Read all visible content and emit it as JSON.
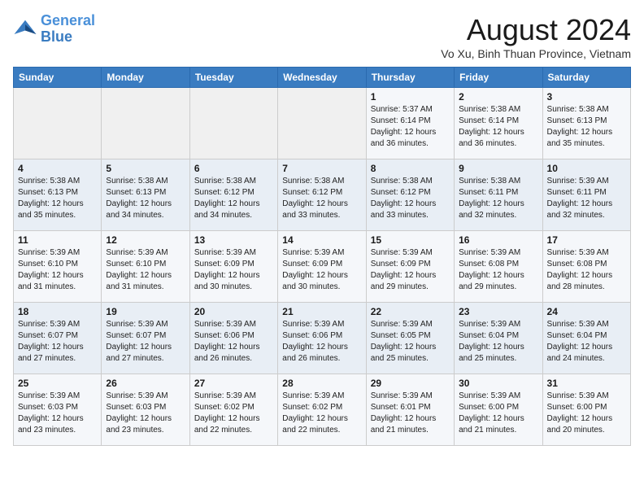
{
  "logo": {
    "line1": "General",
    "line2": "Blue"
  },
  "title": "August 2024",
  "location": "Vo Xu, Binh Thuan Province, Vietnam",
  "days_of_week": [
    "Sunday",
    "Monday",
    "Tuesday",
    "Wednesday",
    "Thursday",
    "Friday",
    "Saturday"
  ],
  "weeks": [
    [
      {
        "day": "",
        "info": ""
      },
      {
        "day": "",
        "info": ""
      },
      {
        "day": "",
        "info": ""
      },
      {
        "day": "",
        "info": ""
      },
      {
        "day": "1",
        "info": "Sunrise: 5:37 AM\nSunset: 6:14 PM\nDaylight: 12 hours\nand 36 minutes."
      },
      {
        "day": "2",
        "info": "Sunrise: 5:38 AM\nSunset: 6:14 PM\nDaylight: 12 hours\nand 36 minutes."
      },
      {
        "day": "3",
        "info": "Sunrise: 5:38 AM\nSunset: 6:13 PM\nDaylight: 12 hours\nand 35 minutes."
      }
    ],
    [
      {
        "day": "4",
        "info": "Sunrise: 5:38 AM\nSunset: 6:13 PM\nDaylight: 12 hours\nand 35 minutes."
      },
      {
        "day": "5",
        "info": "Sunrise: 5:38 AM\nSunset: 6:13 PM\nDaylight: 12 hours\nand 34 minutes."
      },
      {
        "day": "6",
        "info": "Sunrise: 5:38 AM\nSunset: 6:12 PM\nDaylight: 12 hours\nand 34 minutes."
      },
      {
        "day": "7",
        "info": "Sunrise: 5:38 AM\nSunset: 6:12 PM\nDaylight: 12 hours\nand 33 minutes."
      },
      {
        "day": "8",
        "info": "Sunrise: 5:38 AM\nSunset: 6:12 PM\nDaylight: 12 hours\nand 33 minutes."
      },
      {
        "day": "9",
        "info": "Sunrise: 5:38 AM\nSunset: 6:11 PM\nDaylight: 12 hours\nand 32 minutes."
      },
      {
        "day": "10",
        "info": "Sunrise: 5:39 AM\nSunset: 6:11 PM\nDaylight: 12 hours\nand 32 minutes."
      }
    ],
    [
      {
        "day": "11",
        "info": "Sunrise: 5:39 AM\nSunset: 6:10 PM\nDaylight: 12 hours\nand 31 minutes."
      },
      {
        "day": "12",
        "info": "Sunrise: 5:39 AM\nSunset: 6:10 PM\nDaylight: 12 hours\nand 31 minutes."
      },
      {
        "day": "13",
        "info": "Sunrise: 5:39 AM\nSunset: 6:09 PM\nDaylight: 12 hours\nand 30 minutes."
      },
      {
        "day": "14",
        "info": "Sunrise: 5:39 AM\nSunset: 6:09 PM\nDaylight: 12 hours\nand 30 minutes."
      },
      {
        "day": "15",
        "info": "Sunrise: 5:39 AM\nSunset: 6:09 PM\nDaylight: 12 hours\nand 29 minutes."
      },
      {
        "day": "16",
        "info": "Sunrise: 5:39 AM\nSunset: 6:08 PM\nDaylight: 12 hours\nand 29 minutes."
      },
      {
        "day": "17",
        "info": "Sunrise: 5:39 AM\nSunset: 6:08 PM\nDaylight: 12 hours\nand 28 minutes."
      }
    ],
    [
      {
        "day": "18",
        "info": "Sunrise: 5:39 AM\nSunset: 6:07 PM\nDaylight: 12 hours\nand 27 minutes."
      },
      {
        "day": "19",
        "info": "Sunrise: 5:39 AM\nSunset: 6:07 PM\nDaylight: 12 hours\nand 27 minutes."
      },
      {
        "day": "20",
        "info": "Sunrise: 5:39 AM\nSunset: 6:06 PM\nDaylight: 12 hours\nand 26 minutes."
      },
      {
        "day": "21",
        "info": "Sunrise: 5:39 AM\nSunset: 6:06 PM\nDaylight: 12 hours\nand 26 minutes."
      },
      {
        "day": "22",
        "info": "Sunrise: 5:39 AM\nSunset: 6:05 PM\nDaylight: 12 hours\nand 25 minutes."
      },
      {
        "day": "23",
        "info": "Sunrise: 5:39 AM\nSunset: 6:04 PM\nDaylight: 12 hours\nand 25 minutes."
      },
      {
        "day": "24",
        "info": "Sunrise: 5:39 AM\nSunset: 6:04 PM\nDaylight: 12 hours\nand 24 minutes."
      }
    ],
    [
      {
        "day": "25",
        "info": "Sunrise: 5:39 AM\nSunset: 6:03 PM\nDaylight: 12 hours\nand 23 minutes."
      },
      {
        "day": "26",
        "info": "Sunrise: 5:39 AM\nSunset: 6:03 PM\nDaylight: 12 hours\nand 23 minutes."
      },
      {
        "day": "27",
        "info": "Sunrise: 5:39 AM\nSunset: 6:02 PM\nDaylight: 12 hours\nand 22 minutes."
      },
      {
        "day": "28",
        "info": "Sunrise: 5:39 AM\nSunset: 6:02 PM\nDaylight: 12 hours\nand 22 minutes."
      },
      {
        "day": "29",
        "info": "Sunrise: 5:39 AM\nSunset: 6:01 PM\nDaylight: 12 hours\nand 21 minutes."
      },
      {
        "day": "30",
        "info": "Sunrise: 5:39 AM\nSunset: 6:00 PM\nDaylight: 12 hours\nand 21 minutes."
      },
      {
        "day": "31",
        "info": "Sunrise: 5:39 AM\nSunset: 6:00 PM\nDaylight: 12 hours\nand 20 minutes."
      }
    ]
  ]
}
